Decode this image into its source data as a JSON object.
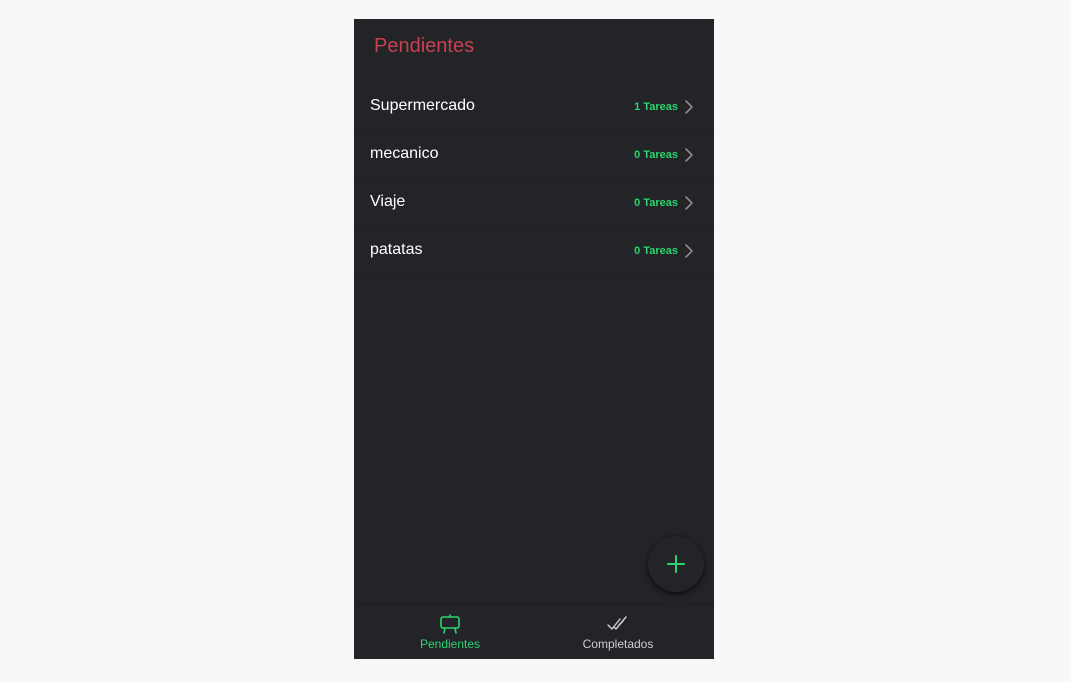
{
  "header": {
    "title": "Pendientes"
  },
  "lists": [
    {
      "name": "Supermercado",
      "count": "1 Tareas"
    },
    {
      "name": "mecanico",
      "count": "0 Tareas"
    },
    {
      "name": "Viaje",
      "count": "0 Tareas"
    },
    {
      "name": "patatas",
      "count": "0 Tareas"
    }
  ],
  "fab": {
    "icon": "add-icon"
  },
  "tabs": [
    {
      "label": "Pendientes",
      "icon": "easel-icon",
      "selected": true
    },
    {
      "label": "Completados",
      "icon": "checkmark-done-icon",
      "selected": false
    }
  ],
  "colors": {
    "background": "#222428",
    "title": "#c8404f",
    "accent": "#2dd36f",
    "text": "#ffffff"
  }
}
